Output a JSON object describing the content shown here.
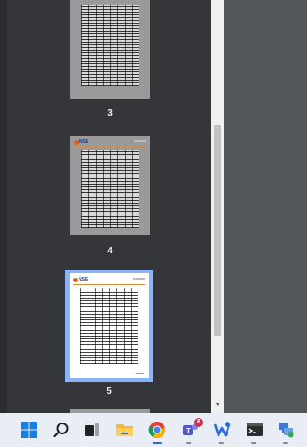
{
  "thumbnails": [
    {
      "page_label": "3",
      "selected": false
    },
    {
      "page_label": "4",
      "selected": false
    },
    {
      "page_label": "5",
      "selected": true
    }
  ],
  "logo_text": "NSE",
  "colors": {
    "panel_bg": "#35363a",
    "selected_frame": "#8ab4f8",
    "right_pane": "#525659",
    "taskbar": "#e9eef6",
    "teams_badge": "#c4314b"
  },
  "taskbar": {
    "items": [
      {
        "name": "start",
        "icon": "windows-logo-icon"
      },
      {
        "name": "search",
        "icon": "search-icon"
      },
      {
        "name": "task-view",
        "icon": "task-view-icon"
      },
      {
        "name": "file-explorer",
        "icon": "folder-icon"
      },
      {
        "name": "chrome",
        "icon": "chrome-icon"
      },
      {
        "name": "teams",
        "icon": "teams-icon",
        "badge": "8"
      },
      {
        "name": "wps",
        "icon": "wps-icon"
      },
      {
        "name": "terminal",
        "icon": "terminal-icon"
      },
      {
        "name": "network-app",
        "icon": "network-app-icon"
      }
    ]
  }
}
